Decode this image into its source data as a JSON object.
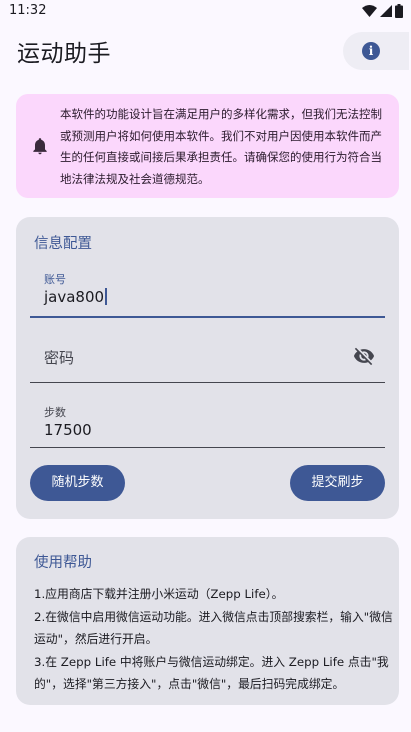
{
  "status_bar": {
    "time": "11:32",
    "icons": [
      "wifi-icon",
      "signal-icon",
      "battery-icon"
    ]
  },
  "app_bar": {
    "title": "运动助手",
    "info_icon": "info-icon"
  },
  "notice": {
    "icon": "bell-icon",
    "text": "本软件的功能设计旨在满足用户的多样化需求，但我们无法控制或预测用户将如何使用本软件。我们不对用户因使用本软件而产生的任何直接或间接后果承担责任。请确保您的使用行为符合当地法律法规及社会道德规范。"
  },
  "config": {
    "title": "信息配置",
    "account": {
      "label": "账号",
      "value": "java800"
    },
    "password": {
      "placeholder": "密码",
      "toggle_icon": "visibility-off-icon"
    },
    "steps": {
      "label": "步数",
      "value": "17500"
    },
    "random_button": "随机步数",
    "submit_button": "提交刷步"
  },
  "help": {
    "title": "使用帮助",
    "items": [
      "1.应用商店下载并注册小米运动（Zepp Life）。",
      "2.在微信中启用微信运动功能。进入微信点击顶部搜索栏，输入\"微信运动\"，然后进行开启。",
      "3.在 Zepp Life 中将账户与微信运动绑定。进入 Zepp Life 点击\"我的\"，选择\"第三方接入\"，点击\"微信\"，最后扫码完成绑定。"
    ]
  },
  "colors": {
    "primary": "#3e5895",
    "notice_bg": "#fbd7fc",
    "card_bg": "#e2e2e9",
    "page_bg": "#fbf8ff"
  }
}
